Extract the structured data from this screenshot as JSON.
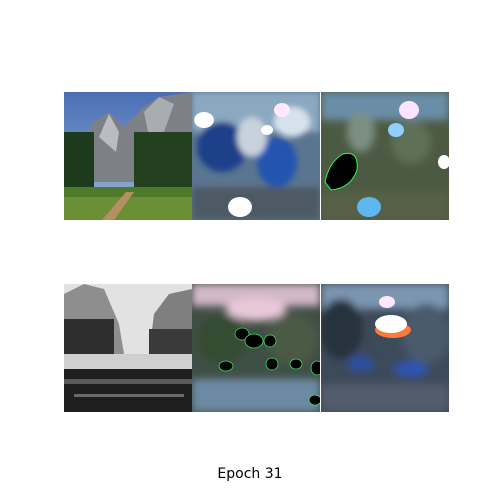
{
  "caption": "Epoch 31",
  "grid": {
    "rows": [
      {
        "panels": [
          {
            "role": "input",
            "subject": "mountain-valley-with-path"
          },
          {
            "role": "output-blurred",
            "subject": "mountain-valley-color-blobs"
          },
          {
            "role": "output-blurred",
            "subject": "mountain-valley-green-blobs"
          }
        ]
      },
      {
        "panels": [
          {
            "role": "input",
            "subject": "grayscale-valley-with-river"
          },
          {
            "role": "output-blurred",
            "subject": "valley-river-dark-spots"
          },
          {
            "role": "output-blurred",
            "subject": "valley-river-bright-spot"
          }
        ]
      }
    ]
  },
  "colors": {
    "background": "#ffffff",
    "caption_text": "#000000"
  }
}
